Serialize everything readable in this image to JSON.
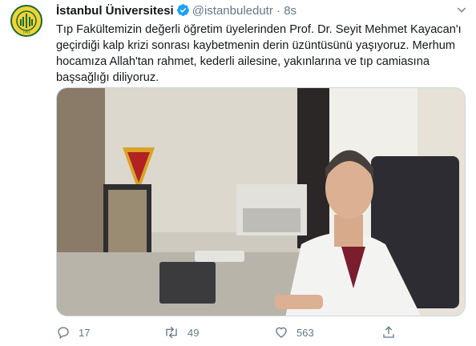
{
  "tweet": {
    "author_name": "İstanbul Üniversitesi",
    "handle": "@istanbuledutr",
    "separator": "·",
    "time": "8s",
    "text": "Tıp Fakültemizin değerli öğretim üyelerinden Prof. Dr. Seyit Mehmet Kayacan'ı geçirdiği kalp krizi sonrası kaybetmenin derin üzüntüsünü yaşıyoruz. Merhum hocamıza Allah'tan rahmet, kederli ailesine, yakınlarına ve tıp camiasına başsağlığı diliyoruz.",
    "logo_year": "1453"
  },
  "actions": {
    "reply_count": "17",
    "retweet_count": "49",
    "like_count": "563"
  },
  "icons": {
    "verified": "verified-badge-icon",
    "caret": "chevron-down-icon",
    "reply": "reply-icon",
    "retweet": "retweet-icon",
    "like": "heart-icon",
    "share": "share-icon"
  },
  "colors": {
    "verified_blue": "#1da1f2",
    "muted_text": "#657786",
    "logo_yellow": "#f3d23a",
    "logo_green": "#1c6a2e"
  }
}
